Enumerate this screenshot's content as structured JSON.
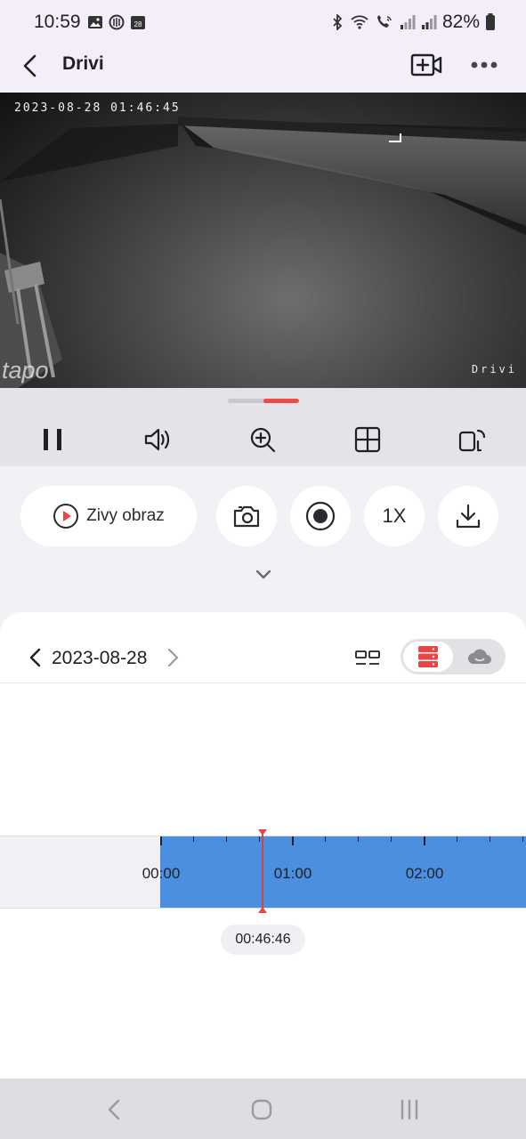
{
  "status_bar": {
    "time": "10:59",
    "battery": "82%",
    "left_icons": [
      "gallery-icon",
      "sync-icon",
      "calendar-icon"
    ],
    "calendar_day": "28",
    "right_icons": [
      "bluetooth-icon",
      "wifi-icon",
      "wifi-calling-icon",
      "signal-icon",
      "signal-icon",
      "battery-icon"
    ]
  },
  "app_bar": {
    "title": "Drivi"
  },
  "video": {
    "timestamp": "2023-08-28 01:46:45",
    "camera_name": "Drivi",
    "logo": "tapo"
  },
  "controls": {
    "items": [
      "pause-icon",
      "volume-icon",
      "zoom-in-icon",
      "multi-view-icon",
      "rotate-screen-icon"
    ]
  },
  "actions": {
    "live_label": "Zivy obraz",
    "speed_label": "1X"
  },
  "date_nav": {
    "date": "2023-08-28"
  },
  "timeline": {
    "labels": [
      "00:00",
      "01:00",
      "02:00"
    ],
    "current_time": "00:46:46",
    "recorded_from": "00:00"
  },
  "colors": {
    "accent": "#e84545",
    "recorded": "#4a8fe0",
    "header_bg": "#f3eef9"
  }
}
